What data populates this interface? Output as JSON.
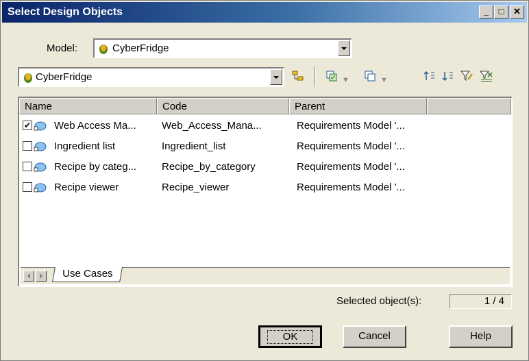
{
  "window": {
    "title": "Select Design Objects",
    "controls": [
      "minimize-icon",
      "maximize-icon",
      "close-icon"
    ]
  },
  "model": {
    "label": "Model:",
    "value": "CyberFridge"
  },
  "package_selector": {
    "value": "CyberFridge"
  },
  "toolbar": {
    "icons": [
      "include-subpackages-icon",
      "select-all-icon",
      "deselect-all-icon",
      "move-to-top-icon",
      "move-to-bottom-icon",
      "filter-icon",
      "clear-filter-icon"
    ]
  },
  "table": {
    "columns": [
      "Name",
      "Code",
      "Parent"
    ],
    "rows": [
      {
        "checked": true,
        "name": "Web Access Ma...",
        "code": "Web_Access_Mana...",
        "parent": "Requirements Model '..."
      },
      {
        "checked": false,
        "name": "Ingredient list",
        "code": "Ingredient_list",
        "parent": "Requirements Model '..."
      },
      {
        "checked": false,
        "name": "Recipe by categ...",
        "code": "Recipe_by_category",
        "parent": "Requirements Model '..."
      },
      {
        "checked": false,
        "name": "Recipe viewer",
        "code": "Recipe_viewer",
        "parent": "Requirements Model '..."
      }
    ]
  },
  "tabs": [
    "Use Cases"
  ],
  "status": {
    "label": "Selected object(s):",
    "count": "1 / 4"
  },
  "buttons": {
    "ok": "OK",
    "cancel": "Cancel",
    "help": "Help"
  },
  "colors": {
    "title_start": "#0a246a",
    "title_end": "#a6caf0",
    "dialog_bg": "#ece9d8"
  }
}
